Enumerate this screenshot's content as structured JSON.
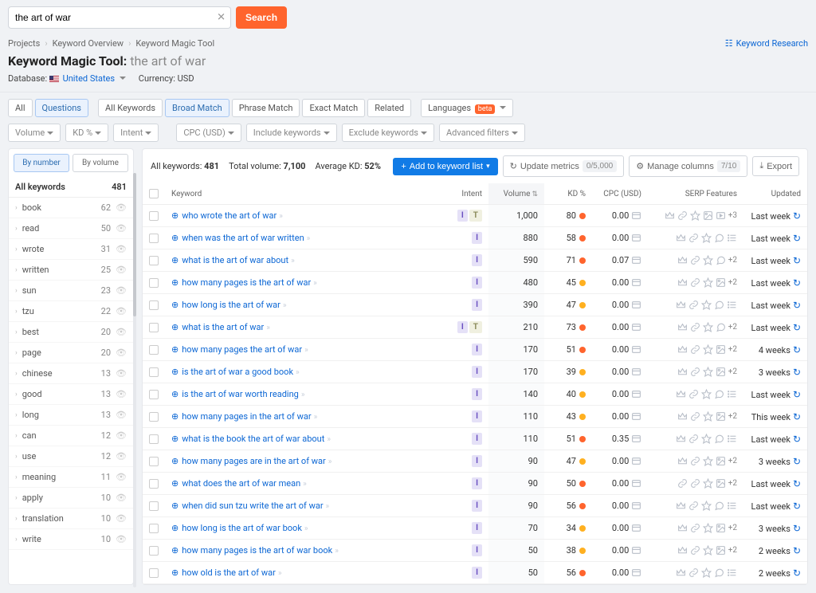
{
  "search": {
    "value": "the art of war",
    "button": "Search"
  },
  "breadcrumbs": {
    "projects": "Projects",
    "overview": "Keyword Overview",
    "tool": "Keyword Magic Tool",
    "research": "Keyword Research"
  },
  "title": {
    "tool": "Keyword Magic Tool:",
    "query": "the art of war"
  },
  "subopts": {
    "db_label": "Database:",
    "db_value": "United States",
    "curr_label": "Currency:",
    "curr_value": "USD"
  },
  "tabs": {
    "all": "All",
    "questions": "Questions",
    "all_kw": "All Keywords",
    "broad": "Broad Match",
    "phrase": "Phrase Match",
    "exact": "Exact Match",
    "related": "Related",
    "lang": "Languages",
    "beta": "beta"
  },
  "filters": {
    "volume": "Volume",
    "kd": "KD %",
    "intent": "Intent",
    "cpc": "CPC (USD)",
    "include": "Include keywords",
    "exclude": "Exclude keywords",
    "advanced": "Advanced filters"
  },
  "sidebar": {
    "by_number": "By number",
    "by_volume": "By volume",
    "head_label": "All keywords",
    "head_count": "481",
    "items": [
      {
        "label": "book",
        "count": "62"
      },
      {
        "label": "read",
        "count": "50"
      },
      {
        "label": "wrote",
        "count": "31"
      },
      {
        "label": "written",
        "count": "25"
      },
      {
        "label": "sun",
        "count": "23"
      },
      {
        "label": "tzu",
        "count": "22"
      },
      {
        "label": "best",
        "count": "20"
      },
      {
        "label": "page",
        "count": "20"
      },
      {
        "label": "chinese",
        "count": "13"
      },
      {
        "label": "good",
        "count": "13"
      },
      {
        "label": "long",
        "count": "13"
      },
      {
        "label": "can",
        "count": "12"
      },
      {
        "label": "use",
        "count": "12"
      },
      {
        "label": "meaning",
        "count": "11"
      },
      {
        "label": "apply",
        "count": "10"
      },
      {
        "label": "translation",
        "count": "10"
      },
      {
        "label": "write",
        "count": "10"
      }
    ]
  },
  "summary": {
    "all_kw_label": "All keywords:",
    "all_kw_val": "481",
    "vol_label": "Total volume:",
    "vol_val": "7,100",
    "kd_label": "Average KD:",
    "kd_val": "52%"
  },
  "actions": {
    "add": "Add to keyword list",
    "update": "Update metrics",
    "update_count": "0/5,000",
    "columns": "Manage columns",
    "col_count": "7/10",
    "export": "Export"
  },
  "columns": {
    "keyword": "Keyword",
    "intent": "Intent",
    "volume": "Volume",
    "kd": "KD %",
    "cpc": "CPC (USD)",
    "serp": "SERP Features",
    "updated": "Updated"
  },
  "rows": [
    {
      "kw": "who wrote the art of war",
      "intent": [
        "I",
        "T"
      ],
      "vol": "1,000",
      "kd": "80",
      "kd_c": "red",
      "cpc": "0.00",
      "serp": [
        "crown",
        "link",
        "star",
        "image",
        "video"
      ],
      "more": "+3",
      "upd": "Last week"
    },
    {
      "kw": "when was the art of war written",
      "intent": [
        "I"
      ],
      "vol": "880",
      "kd": "58",
      "kd_c": "red",
      "cpc": "0.00",
      "serp": [
        "crown",
        "link",
        "star",
        "bubble",
        "list"
      ],
      "more": "",
      "upd": "Last week"
    },
    {
      "kw": "what is the art of war about",
      "intent": [
        "I"
      ],
      "vol": "590",
      "kd": "71",
      "kd_c": "red",
      "cpc": "0.07",
      "serp": [
        "crown",
        "link",
        "star",
        "bubble"
      ],
      "more": "+2",
      "upd": "Last week"
    },
    {
      "kw": "how many pages is the art of war",
      "intent": [
        "I"
      ],
      "vol": "480",
      "kd": "45",
      "kd_c": "orange",
      "cpc": "0.00",
      "serp": [
        "crown",
        "link",
        "star",
        "image"
      ],
      "more": "+2",
      "upd": "Last week"
    },
    {
      "kw": "how long is the art of war",
      "intent": [
        "I"
      ],
      "vol": "390",
      "kd": "47",
      "kd_c": "orange",
      "cpc": "0.00",
      "serp": [
        "crown",
        "link",
        "star",
        "bubble",
        "list"
      ],
      "more": "",
      "upd": "Last week"
    },
    {
      "kw": "what is the art of war",
      "intent": [
        "I",
        "T"
      ],
      "vol": "210",
      "kd": "73",
      "kd_c": "red",
      "cpc": "0.00",
      "serp": [
        "crown",
        "link",
        "star",
        "bubble"
      ],
      "more": "+2",
      "upd": "Last week"
    },
    {
      "kw": "how many pages the art of war",
      "intent": [
        "I"
      ],
      "vol": "170",
      "kd": "51",
      "kd_c": "red",
      "cpc": "0.00",
      "serp": [
        "crown",
        "link",
        "star",
        "image"
      ],
      "more": "+2",
      "upd": "4 weeks"
    },
    {
      "kw": "is the art of war a good book",
      "intent": [
        "I"
      ],
      "vol": "170",
      "kd": "39",
      "kd_c": "orange",
      "cpc": "0.00",
      "serp": [
        "crown",
        "link",
        "star",
        "image"
      ],
      "more": "+2",
      "upd": "3 weeks"
    },
    {
      "kw": "is the art of war worth reading",
      "intent": [
        "I"
      ],
      "vol": "140",
      "kd": "40",
      "kd_c": "orange",
      "cpc": "0.00",
      "serp": [
        "crown",
        "link",
        "star",
        "bubble",
        "list"
      ],
      "more": "",
      "upd": "Last week"
    },
    {
      "kw": "how many pages in the art of war",
      "intent": [
        "I"
      ],
      "vol": "110",
      "kd": "43",
      "kd_c": "orange",
      "cpc": "0.00",
      "serp": [
        "crown",
        "link",
        "star",
        "image"
      ],
      "more": "+2",
      "upd": "This week"
    },
    {
      "kw": "what is the book the art of war about",
      "intent": [
        "I"
      ],
      "vol": "110",
      "kd": "51",
      "kd_c": "red",
      "cpc": "0.35",
      "serp": [
        "crown",
        "link",
        "star",
        "bubble",
        "list"
      ],
      "more": "",
      "upd": "Last week"
    },
    {
      "kw": "how many pages are in the art of war",
      "intent": [
        "I"
      ],
      "vol": "90",
      "kd": "47",
      "kd_c": "orange",
      "cpc": "0.00",
      "serp": [
        "crown",
        "link",
        "star",
        "image"
      ],
      "more": "+2",
      "upd": "3 weeks"
    },
    {
      "kw": "what does the art of war mean",
      "intent": [
        "I"
      ],
      "vol": "90",
      "kd": "50",
      "kd_c": "red",
      "cpc": "0.00",
      "serp": [
        "link",
        "link",
        "star",
        "image"
      ],
      "more": "+2",
      "upd": "Last week"
    },
    {
      "kw": "when did sun tzu write the art of war",
      "intent": [
        "I"
      ],
      "vol": "90",
      "kd": "56",
      "kd_c": "red",
      "cpc": "0.00",
      "serp": [
        "crown",
        "link",
        "star",
        "bubble",
        "list"
      ],
      "more": "",
      "upd": "Last week"
    },
    {
      "kw": "how long is the art of war book",
      "intent": [
        "I"
      ],
      "vol": "70",
      "kd": "34",
      "kd_c": "orange",
      "cpc": "0.00",
      "serp": [
        "crown",
        "link",
        "star",
        "image"
      ],
      "more": "+2",
      "upd": "3 weeks"
    },
    {
      "kw": "how many pages is the art of war book",
      "intent": [
        "I"
      ],
      "vol": "50",
      "kd": "38",
      "kd_c": "orange",
      "cpc": "0.00",
      "serp": [
        "crown",
        "link",
        "star",
        "image"
      ],
      "more": "+2",
      "upd": "2 weeks"
    },
    {
      "kw": "how old is the art of war",
      "intent": [
        "I"
      ],
      "vol": "50",
      "kd": "56",
      "kd_c": "red",
      "cpc": "0.00",
      "serp": [
        "crown",
        "link",
        "star",
        "bubble",
        "list"
      ],
      "more": "",
      "upd": "2 weeks"
    }
  ]
}
